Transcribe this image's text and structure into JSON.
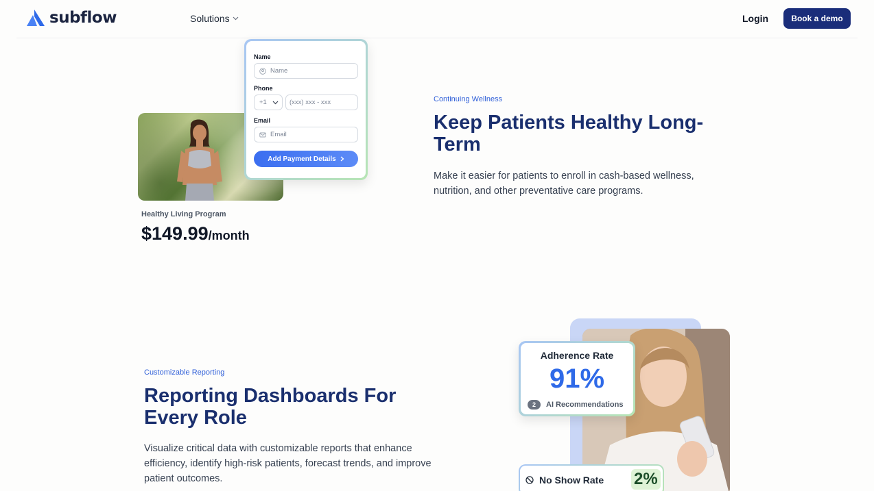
{
  "header": {
    "logo_text": "subflow",
    "nav_solutions": "Solutions",
    "login": "Login",
    "cta": "Book a demo",
    "brand_color": "#1a2d7a",
    "logo_color": "#2f6ae8"
  },
  "section1": {
    "form": {
      "name_label": "Name",
      "name_placeholder": "Name",
      "phone_label": "Phone",
      "country_code": "+1",
      "phone_placeholder": "(xxx) xxx - xxx",
      "email_label": "Email",
      "email_placeholder": "Email",
      "submit": "Add Payment Details"
    },
    "plan_name": "Healthy Living Program",
    "plan_price": "$149.99",
    "plan_period": "/month",
    "eyebrow": "Continuing Wellness",
    "title": "Keep Patients Healthy Long-Term",
    "body": "Make it easier for patients to enroll in cash-based wellness, nutrition, and other preventative care programs."
  },
  "section2": {
    "eyebrow": "Customizable Reporting",
    "title": "Reporting Dashboards For Every Role",
    "body": "Visualize critical data with customizable reports that enhance efficiency, identify high-risk patients, forecast trends, and improve patient outcomes.",
    "adherence_title": "Adherence Rate",
    "adherence_value": "91%",
    "ai_count": "2",
    "ai_label": "AI Recommendations",
    "noshow_label": "No Show Rate",
    "noshow_value": "2%"
  }
}
